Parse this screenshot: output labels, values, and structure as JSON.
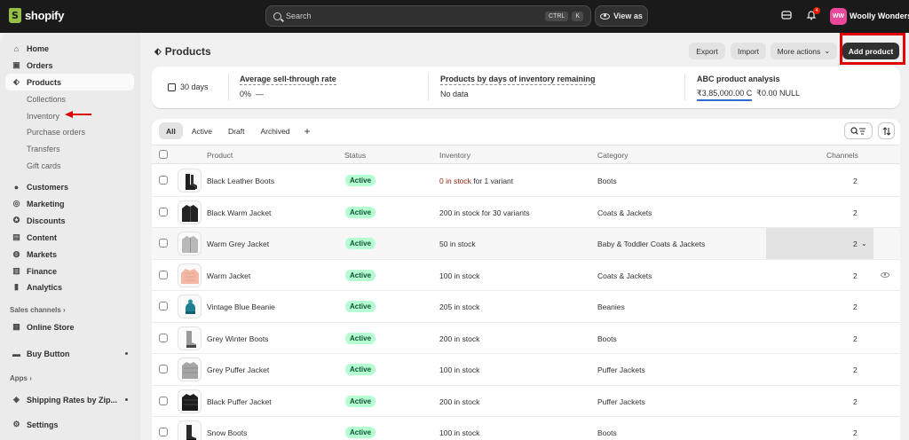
{
  "topbar": {
    "brand": "shopify",
    "search_placeholder": "Search",
    "shortcut_ctrl": "CTRL",
    "shortcut_key": "K",
    "view_as": "View as",
    "notification_count": "4",
    "avatar_initials": "WW",
    "store_name": "Woolly Wonders"
  },
  "sidebar": {
    "items": [
      {
        "label": "Home",
        "icon": "home-icon"
      },
      {
        "label": "Orders",
        "icon": "inbox-icon"
      },
      {
        "label": "Products",
        "icon": "tag-icon"
      },
      {
        "label": "Customers",
        "icon": "person-icon"
      },
      {
        "label": "Marketing",
        "icon": "target-icon"
      },
      {
        "label": "Discounts",
        "icon": "discount-icon"
      },
      {
        "label": "Content",
        "icon": "content-icon"
      },
      {
        "label": "Markets",
        "icon": "globe-icon"
      },
      {
        "label": "Finance",
        "icon": "bank-icon"
      },
      {
        "label": "Analytics",
        "icon": "chart-icon"
      }
    ],
    "product_subitems": [
      "Collections",
      "Inventory",
      "Purchase orders",
      "Transfers",
      "Gift cards"
    ],
    "sales_channels_label": "Sales channels",
    "online_store": "Online Store",
    "buy_button": "Buy Button",
    "apps_label": "Apps",
    "shipping_app": "Shipping Rates by Zip...",
    "settings": "Settings"
  },
  "page": {
    "title": "Products",
    "export": "Export",
    "import": "Import",
    "more_actions": "More actions",
    "add_product": "Add product"
  },
  "stats": {
    "date_range": "30 days",
    "sell_through_title": "Average sell-through rate",
    "sell_through_value": "0%",
    "sell_through_dash": "—",
    "days_inventory_title": "Products by days of inventory remaining",
    "days_inventory_value": "No data",
    "abc_title": "ABC product analysis",
    "abc_value_1": "₹3,85,000.00 C",
    "abc_value_2": "₹0.00 NULL"
  },
  "tabs": [
    "All",
    "Active",
    "Draft",
    "Archived"
  ],
  "table": {
    "headers": {
      "product": "Product",
      "status": "Status",
      "inventory": "Inventory",
      "category": "Category",
      "channels": "Channels"
    },
    "rows": [
      {
        "name": "Black Leather Boots",
        "status": "Active",
        "inv_zero": "0 in stock",
        "inventory": " for 1 variant",
        "category": "Boots",
        "channels": "2",
        "thumb": "boot-black"
      },
      {
        "name": "Black Warm Jacket",
        "status": "Active",
        "inv_zero": "",
        "inventory": "200 in stock for 30 variants",
        "category": "Coats & Jackets",
        "channels": "2",
        "thumb": "jacket-black"
      },
      {
        "name": "Warm Grey Jacket",
        "status": "Active",
        "inv_zero": "",
        "inventory": "50 in stock",
        "category": "Baby & Toddler Coats & Jackets",
        "channels": "2",
        "thumb": "jacket-grey"
      },
      {
        "name": "Warm Jacket",
        "status": "Active",
        "inv_zero": "",
        "inventory": "100 in stock",
        "category": "Coats & Jackets",
        "channels": "2",
        "thumb": "jacket-pink"
      },
      {
        "name": "Vintage Blue Beanie",
        "status": "Active",
        "inv_zero": "",
        "inventory": "205 in stock",
        "category": "Beanies",
        "channels": "2",
        "thumb": "beanie-blue"
      },
      {
        "name": "Grey Winter Boots",
        "status": "Active",
        "inv_zero": "",
        "inventory": "200 in stock",
        "category": "Boots",
        "channels": "2",
        "thumb": "boot-grey"
      },
      {
        "name": "Grey Puffer Jacket",
        "status": "Active",
        "inv_zero": "",
        "inventory": "100 in stock",
        "category": "Puffer Jackets",
        "channels": "2",
        "thumb": "puffer-grey"
      },
      {
        "name": "Black Puffer Jacket",
        "status": "Active",
        "inv_zero": "",
        "inventory": "200 in stock",
        "category": "Puffer Jackets",
        "channels": "2",
        "thumb": "puffer-black"
      },
      {
        "name": "Snow Boots",
        "status": "Active",
        "inv_zero": "",
        "inventory": "100 in stock",
        "category": "Boots",
        "channels": "2",
        "thumb": "boot-snow"
      }
    ]
  },
  "colors": {
    "accent": "#303030",
    "status_active_bg": "#b4fed2",
    "highlight": "#e00000",
    "avatar": "#e9479a"
  }
}
